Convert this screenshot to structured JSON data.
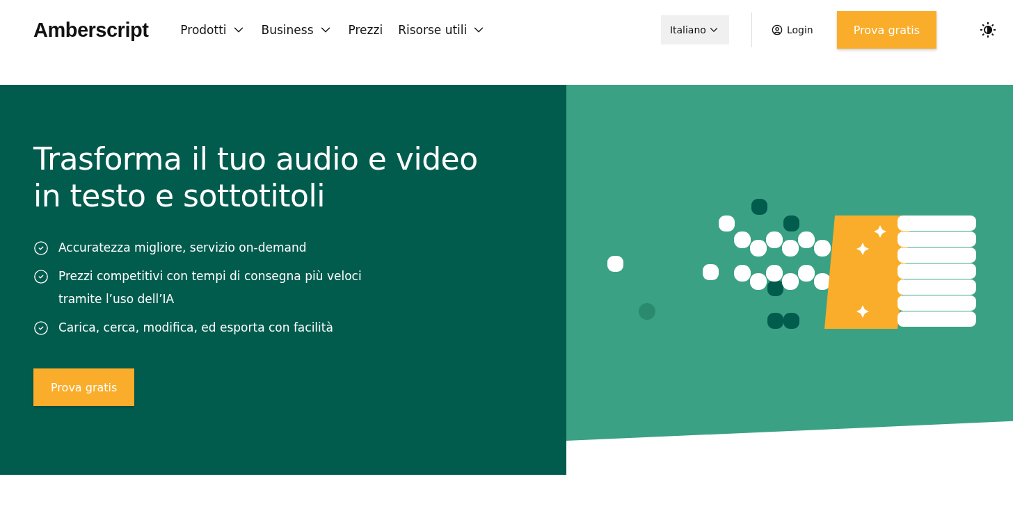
{
  "header": {
    "logo": "Amberscript",
    "nav": [
      {
        "label": "Prodotti",
        "dropdown": true
      },
      {
        "label": "Business",
        "dropdown": true
      },
      {
        "label": "Prezzi",
        "dropdown": false
      },
      {
        "label": "Risorse utili",
        "dropdown": true
      }
    ],
    "language": "Italiano",
    "login": "Login",
    "cta": "Prova gratis"
  },
  "hero": {
    "title": "Trasforma il tuo audio e video\nin testo e sottotitoli",
    "features": [
      "Accuratezza migliore, servizio on-demand",
      "Prezzi competitivi con tempi di consegna più veloci\ntramite l’uso dell’IA",
      "Carica, cerca, modifica, ed esporta con facilità"
    ],
    "cta": "Prova gratis"
  }
}
